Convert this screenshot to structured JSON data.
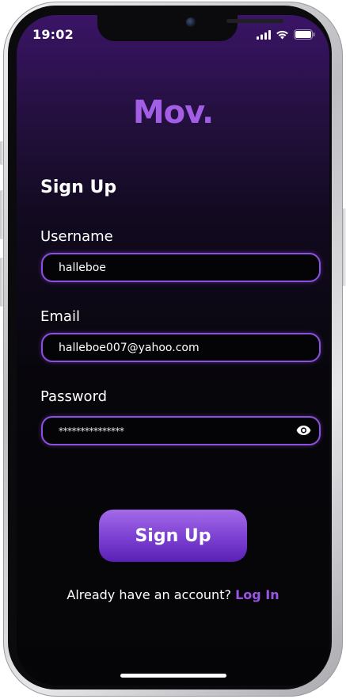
{
  "status_bar": {
    "time": "19:02"
  },
  "app": {
    "logo": "Mov.",
    "title": "Sign Up"
  },
  "form": {
    "username": {
      "label": "Username",
      "value": "halleboe"
    },
    "email": {
      "label": "Email",
      "value": "halleboe007@yahoo.com"
    },
    "password": {
      "label": "Password",
      "value": "***************"
    },
    "submit_label": "Sign Up"
  },
  "footer": {
    "prompt": "Already have an account?",
    "link_label": "Log In"
  },
  "colors": {
    "accent": "#8d4fe0",
    "link": "#9b55e6",
    "logo": "#a35ee6"
  },
  "icons": {
    "signal": "cellular-signal-icon",
    "wifi": "wifi-icon",
    "battery": "battery-icon",
    "password_toggle": "eye-icon"
  }
}
